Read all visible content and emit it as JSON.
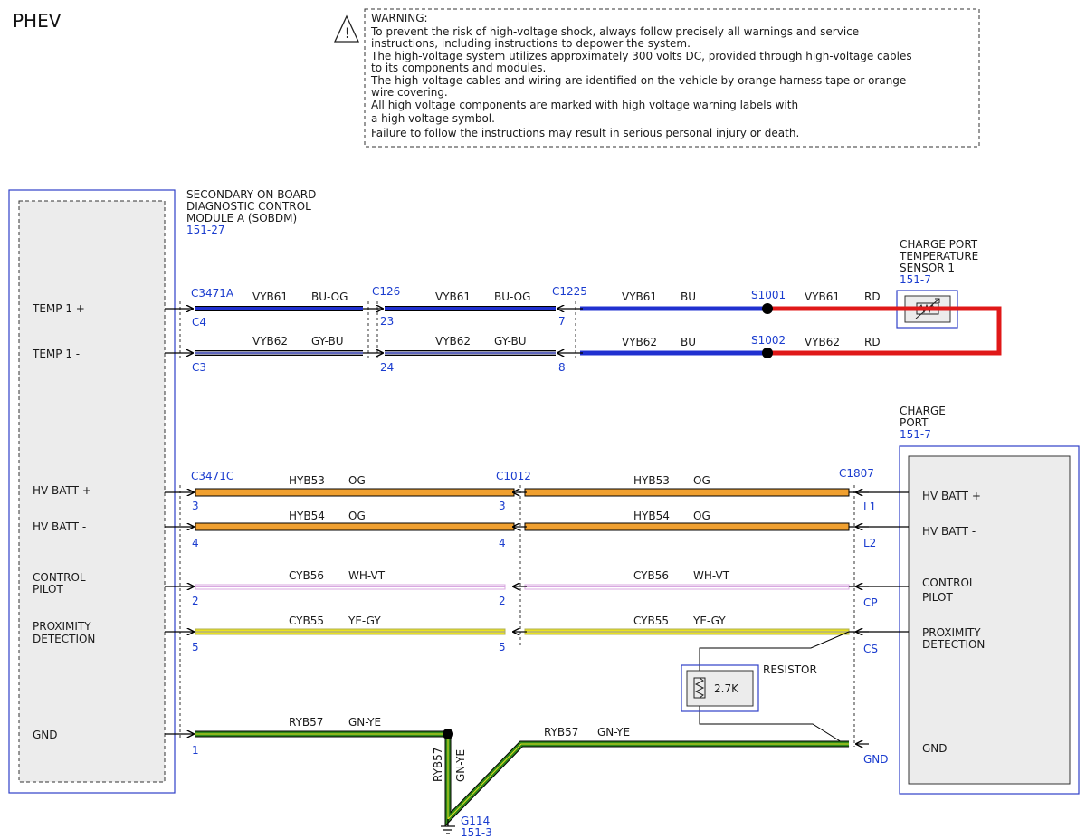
{
  "title": "PHEV",
  "warning": {
    "heading": "WARNING:",
    "lines": [
      "To prevent the risk of high-voltage shock, always follow precisely all warnings and service",
      "instructions, including instructions to depower the system.",
      "The high-voltage system utilizes approximately 300 volts DC, provided through high-voltage cables",
      "to its components and modules.",
      "The high-voltage cables and wiring are identified on the vehicle by orange harness tape or orange",
      "wire covering.",
      "All high voltage components are marked with high voltage warning labels with",
      "a high voltage symbol.",
      "Failure to follow the instructions may result in serious personal injury or death."
    ]
  },
  "sobdm": {
    "name_lines": [
      "SECONDARY ON-BOARD",
      "DIAGNOSTIC CONTROL",
      "MODULE A (SOBDM)"
    ],
    "ref": "151-27",
    "pins": {
      "temp1_plus": "TEMP 1 +",
      "temp1_minus": "TEMP 1 -",
      "hv_plus": "HV BATT +",
      "hv_minus": "HV BATT -",
      "control_pilot": [
        "CONTROL",
        "PILOT"
      ],
      "proximity": [
        "PROXIMITY",
        "DETECTION"
      ],
      "gnd": "GND"
    }
  },
  "sensor": {
    "name_lines": [
      "CHARGE PORT",
      "TEMPERATURE",
      "SENSOR 1"
    ],
    "ref": "151-7"
  },
  "charge_port": {
    "name_lines": [
      "CHARGE",
      "PORT"
    ],
    "ref": "151-7",
    "pins": {
      "hv_plus": "HV BATT +",
      "hv_minus": "HV BATT -",
      "control_pilot": [
        "CONTROL",
        "PILOT"
      ],
      "proximity": [
        "PROXIMITY",
        "DETECTION"
      ],
      "gnd": "GND"
    },
    "pin_ids": {
      "hv_plus": "L1",
      "hv_minus": "L2",
      "cp": "CP",
      "cs": "CS",
      "gnd": "GND"
    }
  },
  "connectors": {
    "c3471a": "C3471A",
    "c126": "C126",
    "c1225": "C1225",
    "c3471c": "C3471C",
    "c1012": "C1012",
    "c1807": "C1807"
  },
  "splices": {
    "s1001": "S1001",
    "s1002": "S1002"
  },
  "pins": {
    "c3471a_temp_plus": "C4",
    "c3471a_temp_minus": "C3",
    "c126_temp_plus": "23",
    "c126_temp_minus": "24",
    "c1225_temp_plus": "7",
    "c1225_temp_minus": "8",
    "c3471c_hv_plus": "3",
    "c3471c_hv_minus": "4",
    "c3471c_cp": "2",
    "c3471c_prox": "5",
    "c3471c_gnd": "1",
    "c1012_hv_plus": "3",
    "c1012_hv_minus": "4",
    "c1012_cp": "2",
    "c1012_prox": "5"
  },
  "circuits": {
    "vyb61": "VYB61",
    "vyb62": "VYB62",
    "hyb53": "HYB53",
    "hyb54": "HYB54",
    "cyb56": "CYB56",
    "cyb55": "CYB55",
    "ryb57": "RYB57"
  },
  "wire_colors": {
    "bu_og": "BU-OG",
    "gy_bu": "GY-BU",
    "bu": "BU",
    "rd": "RD",
    "og": "OG",
    "wh_vt": "WH-VT",
    "ye_gy": "YE-GY",
    "gn_ye": "GN-YE"
  },
  "resistor": {
    "label": "RESISTOR",
    "value": "2.7K"
  },
  "ground": {
    "name": "G114",
    "ref": "151-3"
  },
  "colors": {
    "blue": "#2030d0",
    "red": "#e01818",
    "orange": "#f0a030",
    "green": "#2f8a1a",
    "yellow": "#e8e020",
    "violet": "#d8a8e0",
    "gray": "#9a9aaa",
    "component_border": "#3040c8"
  }
}
